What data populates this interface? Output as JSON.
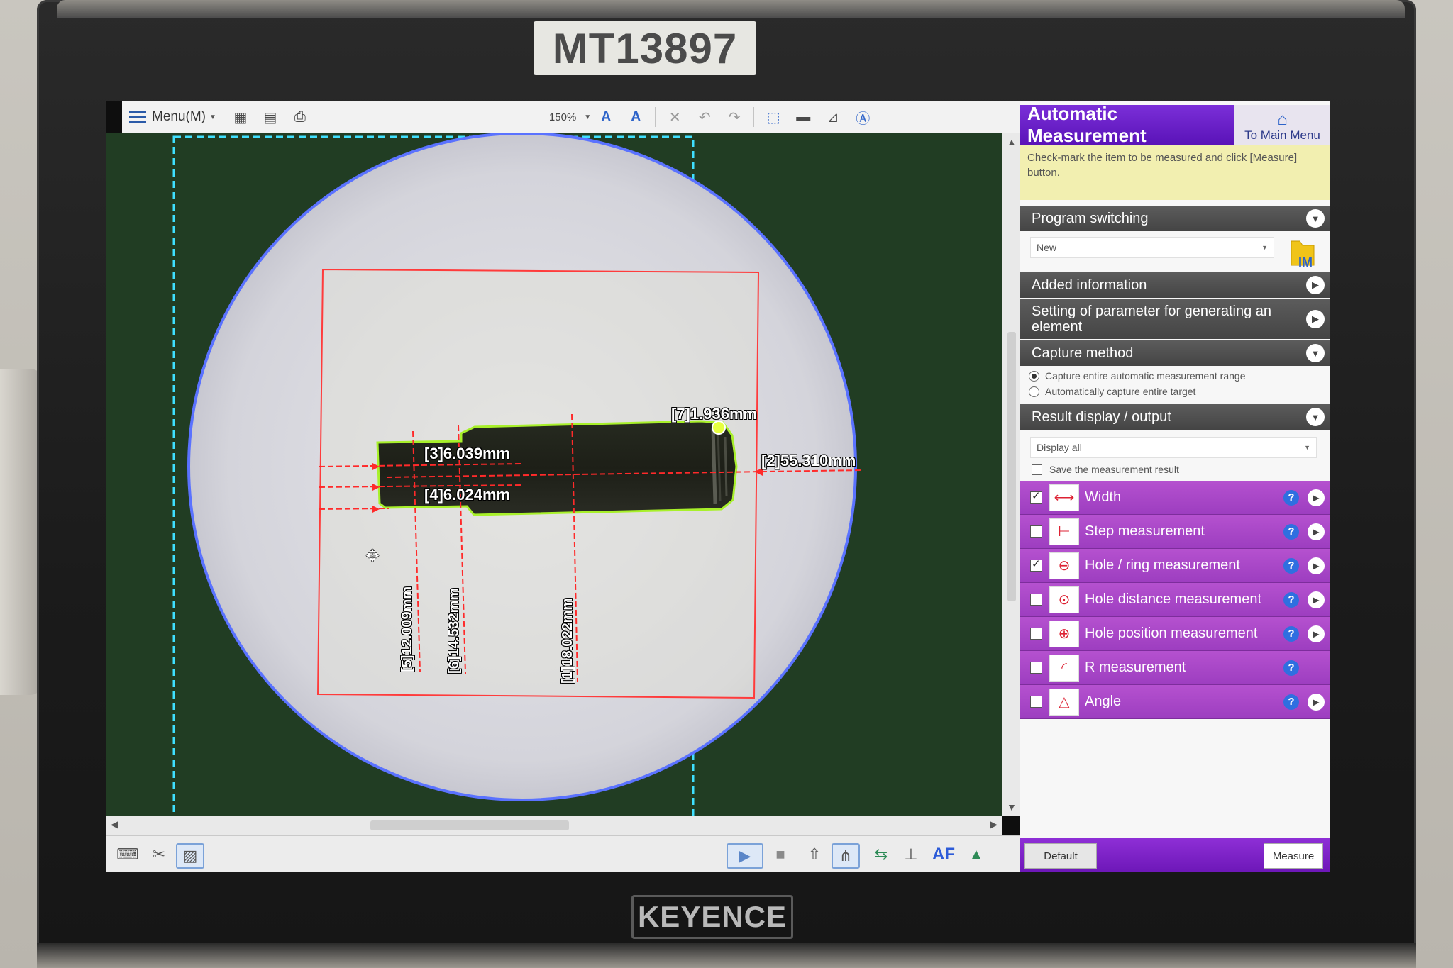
{
  "device": {
    "asset_tag": "MT13897",
    "brand": "KEYENCE"
  },
  "toolbar": {
    "menu_label": "Menu(M)",
    "zoom_level": "150%"
  },
  "viewer": {
    "measurements": [
      {
        "id": "1",
        "label": "[1]18.022mm"
      },
      {
        "id": "2",
        "label": "[2]55.310mm"
      },
      {
        "id": "3",
        "label": "[3]6.039mm"
      },
      {
        "id": "4",
        "label": "[4]6.024mm"
      },
      {
        "id": "5",
        "label": "[5]12.009mm"
      },
      {
        "id": "6",
        "label": "[6]14.532mm"
      },
      {
        "id": "7",
        "label": "[7]1.936mm"
      }
    ]
  },
  "bottombar": {
    "af_label": "AF"
  },
  "panel": {
    "title": "Automatic Measurement",
    "home_label": "To Main Menu",
    "instructions": "Check-mark the item to be measured and click [Measure] button.",
    "sections": {
      "program_switching": "Program switching",
      "added_information": "Added information",
      "parameter_setting": "Setting of parameter for generating an element",
      "capture_method": "Capture method",
      "result_display": "Result display / output"
    },
    "program_select_value": "New",
    "program_folder_label": "IM",
    "capture_options": [
      {
        "label": "Capture entire automatic measurement range",
        "selected": true
      },
      {
        "label": "Automatically capture entire target",
        "selected": false
      }
    ],
    "display_select_value": "Display all",
    "save_result_label": "Save the measurement result",
    "save_result_checked": false,
    "items": [
      {
        "label": "Width",
        "checked": true,
        "icon": "width-icon"
      },
      {
        "label": "Step measurement",
        "checked": false,
        "icon": "step-icon"
      },
      {
        "label": "Hole / ring measurement",
        "checked": true,
        "icon": "hole-ring-icon"
      },
      {
        "label": "Hole distance measurement",
        "checked": false,
        "icon": "hole-distance-icon"
      },
      {
        "label": "Hole position measurement",
        "checked": false,
        "icon": "hole-position-icon"
      },
      {
        "label": "R measurement",
        "checked": false,
        "icon": "radius-icon"
      },
      {
        "label": "Angle",
        "checked": false,
        "icon": "angle-icon"
      }
    ],
    "default_button": "Default",
    "measure_button": "Measure"
  },
  "colors": {
    "accent_purple": "#9d3ec0",
    "header_purple": "#6d17b8",
    "viewer_bg": "#213d23",
    "measure_red": "#ff2a2a",
    "edge_green": "#b6ff2a"
  }
}
